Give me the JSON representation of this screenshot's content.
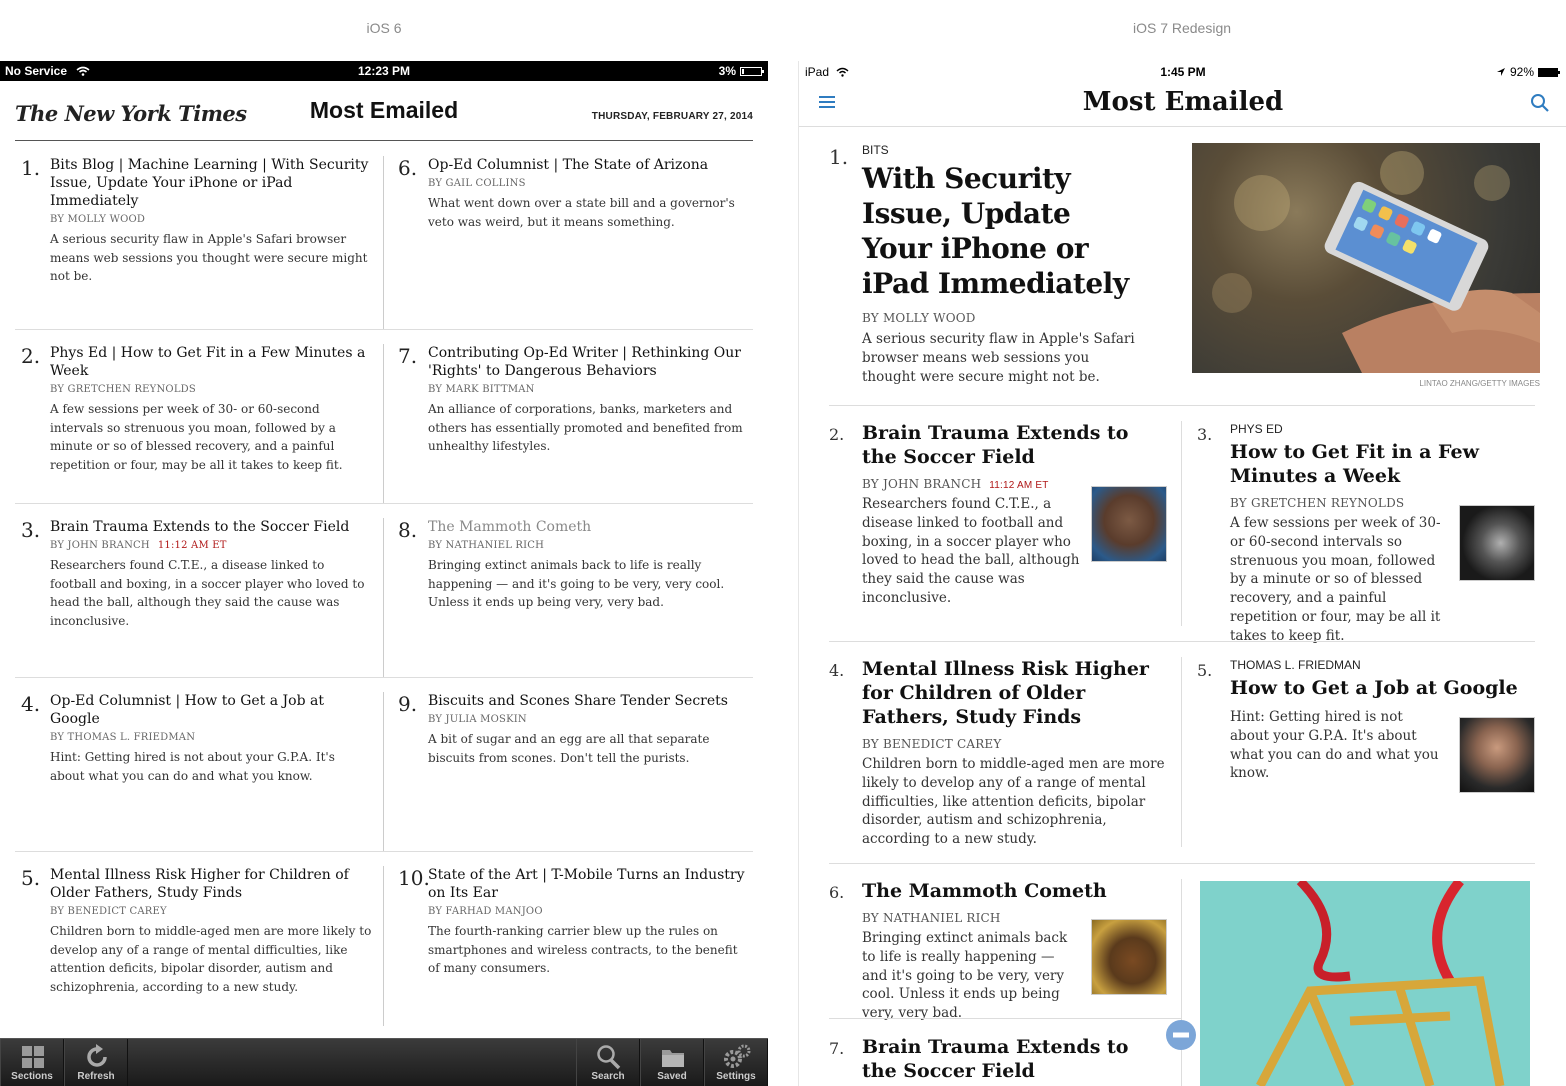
{
  "captions": {
    "left": "iOS 6",
    "right": "iOS 7 Redesign"
  },
  "ios6": {
    "status": {
      "carrier": "No Service",
      "time": "12:23 PM",
      "battery": "3%"
    },
    "header": {
      "logo": "The New York Times",
      "title": "Most Emailed",
      "date": "THURSDAY, FEBRUARY 27, 2014"
    },
    "articles": [
      {
        "num": "1.",
        "headline": "Bits Blog | Machine Learning  |  With Security Issue, Update Your iPhone or iPad Immediately",
        "byline": "By MOLLY WOOD",
        "time": "",
        "summary": "A serious security flaw in Apple's Safari browser means web sessions you thought were secure might not be."
      },
      {
        "num": "6.",
        "headline": "Op-Ed Columnist  |  The State of Arizona",
        "byline": "By GAIL COLLINS",
        "time": "",
        "summary": "What went down over a state bill and a governor's veto was weird, but it means something."
      },
      {
        "num": "2.",
        "headline": "Phys Ed  |  How to Get Fit in a Few Minutes a Week",
        "byline": "By GRETCHEN REYNOLDS",
        "time": "",
        "summary": "A few sessions per week of 30- or 60-second intervals so strenuous you moan, followed by a minute or so of blessed recovery, and a painful repetition or four, may be all it takes to keep fit."
      },
      {
        "num": "7.",
        "headline": "Contributing Op-Ed Writer  |  Rethinking Our 'Rights' to Dangerous Behaviors",
        "byline": "By MARK BITTMAN",
        "time": "",
        "summary": "An alliance of corporations, banks, marketers and others has essentially promoted and benefited from unhealthy lifestyles."
      },
      {
        "num": "3.",
        "headline": "Brain Trauma Extends to the Soccer Field",
        "byline": "By JOHN BRANCH",
        "time": "11:12 AM ET",
        "summary": "Researchers found C.T.E., a disease linked to football and boxing, in a soccer player who loved to head the ball, although they said the cause was inconclusive."
      },
      {
        "num": "8.",
        "headline": "The Mammoth Cometh",
        "byline": "By NATHANIEL RICH",
        "time": "",
        "summary": "Bringing extinct animals back to life is really happening — and it's going to be very, very cool. Unless it ends up being very, very bad."
      },
      {
        "num": "4.",
        "headline": "Op-Ed Columnist  |  How to Get a Job at Google",
        "byline": "By THOMAS L. FRIEDMAN",
        "time": "",
        "summary": "Hint: Getting hired is not about your G.P.A. It's about what you can do and what you know."
      },
      {
        "num": "9.",
        "headline": "Biscuits and Scones Share Tender Secrets",
        "byline": "By JULIA MOSKIN",
        "time": "",
        "summary": "A bit of sugar and an egg are all that separate biscuits from scones. Don't tell the purists."
      },
      {
        "num": "5.",
        "headline": "Mental Illness Risk Higher for Children of Older Fathers, Study Finds",
        "byline": "By BENEDICT CAREY",
        "time": "",
        "summary": "Children born to middle-aged men are more likely to develop any of a range of mental difficulties, like attention deficits, bipolar disorder, autism and schizophrenia, according to a new study."
      },
      {
        "num": "10.",
        "headline": "State of the Art  |  T-Mobile Turns an Industry on Its Ear",
        "byline": "By FARHAD MANJOO",
        "time": "",
        "summary": "The fourth-ranking carrier blew up the rules on smartphones and wireless contracts, to the benefit of many consumers."
      }
    ],
    "toolbar": {
      "sections": "Sections",
      "refresh": "Refresh",
      "search": "Search",
      "saved": "Saved",
      "settings": "Settings"
    }
  },
  "ios7": {
    "status": {
      "device": "iPad",
      "time": "1:45 PM",
      "battery": "92%"
    },
    "header": {
      "title": "Most Emailed"
    },
    "a1": {
      "num": "1.",
      "kicker": "BITS",
      "headline": "With Security Issue, Update Your iPhone or iPad Immediately",
      "byline": "By MOLLY WOOD",
      "summary": "A serious security flaw in Apple's Safari browser means web sessions you thought were secure might not be.",
      "credit": "LINTAO ZHANG/GETTY IMAGES"
    },
    "a2": {
      "num": "2.",
      "headline": "Brain Trauma Extends to the Soccer Field",
      "byline": "By JOHN BRANCH",
      "time": "11:12 AM ET",
      "summary": "Researchers found C.T.E., a disease linked to football and boxing, in a soccer player who loved to head the ball, although they said the cause was inconclusive."
    },
    "a3": {
      "num": "3.",
      "kicker": "PHYS ED",
      "headline": "How to Get Fit in a Few Minutes a Week",
      "byline": "By GRETCHEN REYNOLDS",
      "summary": "A few sessions per week of 30- or 60-second intervals so strenuous you moan, followed by a minute or so of blessed recovery, and a painful repetition or four, may be all it takes to keep fit."
    },
    "a4": {
      "num": "4.",
      "headline": "Mental Illness Risk Higher for Children of Older Fathers, Study Finds",
      "byline": "By BENEDICT CAREY",
      "summary": "Children born to middle-aged men are more likely to develop any of a range of mental difficulties, like attention deficits, bipolar disorder, autism and schizophrenia, according to a new study."
    },
    "a5": {
      "num": "5.",
      "kicker": "THOMAS L. FRIEDMAN",
      "headline": "How to Get a Job at Google",
      "summary": "Hint: Getting hired is not about your G.P.A. It's about what you can do and what you know."
    },
    "a6": {
      "num": "6.",
      "headline": "The Mammoth Cometh",
      "byline": "By NATHANIEL RICH",
      "summary": "Bringing extinct animals back to life is really happening — and it's going to be very, very cool. Unless it ends up being very, very bad."
    },
    "a7": {
      "num": "7.",
      "headline": "Brain Trauma Extends to the Soccer Field"
    }
  }
}
